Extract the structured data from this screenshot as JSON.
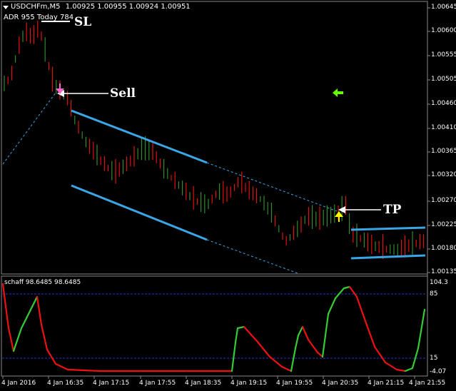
{
  "header": {
    "symbol": "USDCHFm,M5",
    "ohlc": "1.00925 1.00955 1.00924 1.00951",
    "adr": "ADR 955  Today 784"
  },
  "annotations": {
    "sl": "SL",
    "sell": "Sell",
    "tp": "TP"
  },
  "price_axis": [
    "1.00645",
    "1.00600",
    "1.00555",
    "1.00505",
    "1.00460",
    "1.00410",
    "1.00365",
    "1.00320",
    "1.00270",
    "1.00225",
    "1.00180",
    "1.00135"
  ],
  "time_axis": [
    "4 Jan 2016",
    "4 Jan 16:35",
    "4 Jan 17:15",
    "4 Jan 17:55",
    "4 Jan 18:35",
    "4 Jan 19:15",
    "4 Jan 19:55",
    "4 Jan 20:35",
    "4 Jan 21:15",
    "4 Jan 21:55"
  ],
  "indicator": {
    "title": "schaff 98.6485 98.6485",
    "levels": [
      "104.3",
      "85",
      "15",
      "-4.07"
    ],
    "level_values": [
      85,
      15
    ]
  },
  "colors": {
    "bull": "#2e8b2e",
    "bear": "#e01010",
    "channel": "#3aa6e6",
    "level": "#2233cc",
    "sell_arrow": "#ff66cc",
    "tp_arrow": "#ffff00",
    "signal_arrow": "#66ff00"
  }
}
